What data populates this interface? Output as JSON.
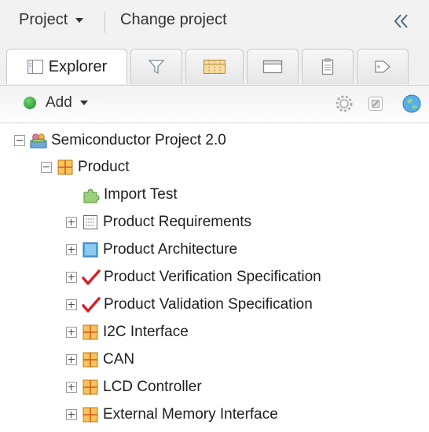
{
  "header": {
    "project_menu_label": "Project",
    "change_project_label": "Change project",
    "collapse_glyph": "«"
  },
  "tabs": [
    {
      "id": "explorer",
      "label": "Explorer",
      "icon": "explorer-icon",
      "active": true
    },
    {
      "id": "filter",
      "label": "",
      "icon": "filter-icon"
    },
    {
      "id": "reviews",
      "label": "",
      "icon": "grid-icon"
    },
    {
      "id": "window",
      "label": "",
      "icon": "window-icon"
    },
    {
      "id": "clipboard",
      "label": "",
      "icon": "clipboard-icon"
    },
    {
      "id": "tags",
      "label": "",
      "icon": "tag-icon"
    }
  ],
  "toolbar": {
    "add_label": "Add",
    "icons": [
      "gear-icon",
      "copy-icon",
      "globe-icon"
    ]
  },
  "tree": {
    "root": {
      "label": "Semiconductor Project 2.0",
      "icon": "project-icon",
      "expanded": true
    },
    "product": {
      "label": "Product",
      "icon": "folder-icon",
      "expanded": true
    },
    "children": [
      {
        "label": "Import Test",
        "icon": "puzzle-icon",
        "expandable": false
      },
      {
        "label": "Product Requirements",
        "icon": "list-icon",
        "expandable": true
      },
      {
        "label": "Product Architecture",
        "icon": "architecture-icon",
        "expandable": true
      },
      {
        "label": "Product Verification Specification",
        "icon": "checkmark-icon",
        "expandable": true
      },
      {
        "label": "Product Validation Specification",
        "icon": "checkmark-icon",
        "expandable": true
      },
      {
        "label": "I2C Interface",
        "icon": "folder-icon",
        "expandable": true
      },
      {
        "label": "CAN",
        "icon": "folder-icon",
        "expandable": true
      },
      {
        "label": "LCD Controller",
        "icon": "folder-icon",
        "expandable": true
      },
      {
        "label": "External Memory Interface",
        "icon": "folder-icon",
        "expandable": true
      }
    ]
  },
  "colors": {
    "add_green": "#1e8b2a",
    "check_red": "#d2232a",
    "folder_orange": "#f0b030",
    "architecture_blue": "#4aa8e8"
  }
}
